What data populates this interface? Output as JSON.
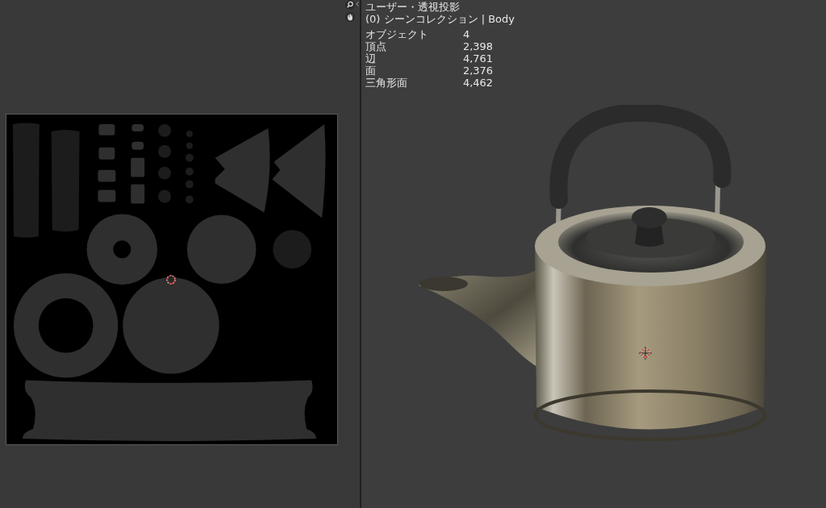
{
  "viewport": {
    "view_mode": "ユーザー・透視投影",
    "collection": "(0) シーンコレクション | Body",
    "stats": [
      {
        "label": "オブジェクト",
        "value": "4"
      },
      {
        "label": "頂点",
        "value": "2,398"
      },
      {
        "label": "辺",
        "value": "4,761"
      },
      {
        "label": "面",
        "value": "2,376"
      },
      {
        "label": "三角形面",
        "value": "4,462"
      }
    ]
  }
}
